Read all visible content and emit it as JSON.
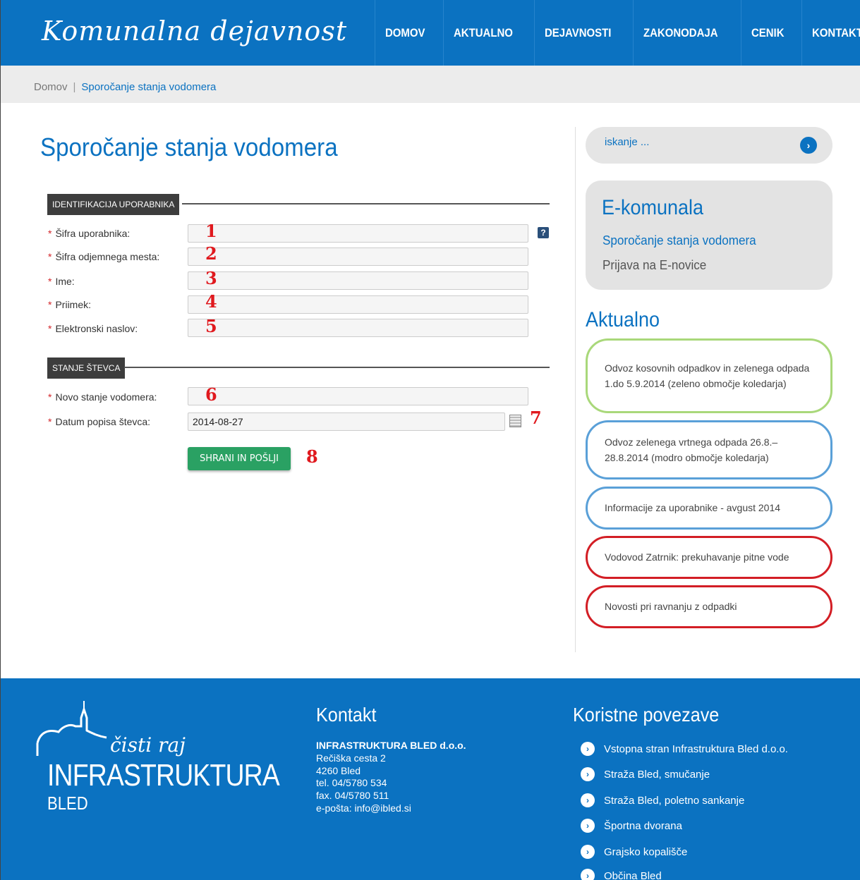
{
  "header": {
    "logo": "Komunalna dejavnost",
    "nav": [
      "DOMOV",
      "AKTUALNO",
      "DEJAVNOSTI",
      "ZAKONODAJA",
      "CENIK",
      "KONTAKT"
    ]
  },
  "breadcrumb": {
    "home": "Domov",
    "separator": "|",
    "current": "Sporočanje stanja vodomera"
  },
  "main": {
    "title": "Sporočanje stanja vodomera",
    "section1": "IDENTIFIKACIJA UPORABNIKA",
    "section2": "STANJE ŠTEVCA",
    "required_marker": "*",
    "fields": [
      {
        "label": "Šifra uporabnika:",
        "value": "",
        "marker": "1"
      },
      {
        "label": "Šifra odjemnega mesta:",
        "value": "",
        "marker": "2"
      },
      {
        "label": "Ime:",
        "value": "",
        "marker": "3"
      },
      {
        "label": "Priimek:",
        "value": "",
        "marker": "4"
      },
      {
        "label": "Elektronski naslov:",
        "value": "",
        "marker": "5"
      },
      {
        "label": "Novo stanje vodomera:",
        "value": "",
        "marker": "6"
      },
      {
        "label": "Datum popisa števca:",
        "value": "2014-08-27",
        "marker": "7"
      }
    ],
    "help_icon": "?",
    "submit_label": "SHRANI IN POŠLJI",
    "submit_marker": "8"
  },
  "sidebar": {
    "search_placeholder": "iskanje ...",
    "search_button": "›",
    "ekomunala": {
      "title": "E-komunala",
      "link1": "Sporočanje stanja vodomera",
      "link2": "Prijava na E-novice"
    },
    "aktualno_title": "Aktualno",
    "news": [
      {
        "text": "Odvoz kosovnih odpadkov in zelenega odpada 1.do 5.9.2014 (zeleno območje koledarja)",
        "color": "#a9d87a"
      },
      {
        "text": "Odvoz zelenega vrtnega odpada 26.8.–28.8.2014 (modro območje koledarja)",
        "color": "#5aa0d8"
      },
      {
        "text": "Informacije za uporabnike - avgust 2014",
        "color": "#5aa0d8"
      },
      {
        "text": "Vodovod Zatrnik: prekuhavanje pitne vode",
        "color": "#d31e25"
      },
      {
        "text": "Novosti pri ravnanju z odpadki",
        "color": "#d31e25"
      }
    ]
  },
  "footer": {
    "logo_script": "čisti raj",
    "logo_main": "INFRASTRUKTURA",
    "logo_sub": "BLED",
    "kontakt_title": "Kontakt",
    "company": "INFRASTRUKTURA BLED d.o.o.",
    "address1": "Rečiška cesta 2",
    "address2": "4260 Bled",
    "tel": "tel. 04/5780 534",
    "fax": "fax. 04/5780 511",
    "email": "e-pošta: info@ibled.si",
    "links_title": "Koristne povezave",
    "link_bullet": "›",
    "links": [
      "Vstopna stran Infrastruktura Bled d.o.o.",
      "Straža Bled, smučanje",
      "Straža Bled, poletno sankanje",
      "Športna dvorana",
      "Grajsko kopališče",
      "Občina Bled"
    ]
  },
  "colors": {
    "brand": "#0b72c1",
    "button": "#2aa163",
    "marker": "#e0191e"
  }
}
